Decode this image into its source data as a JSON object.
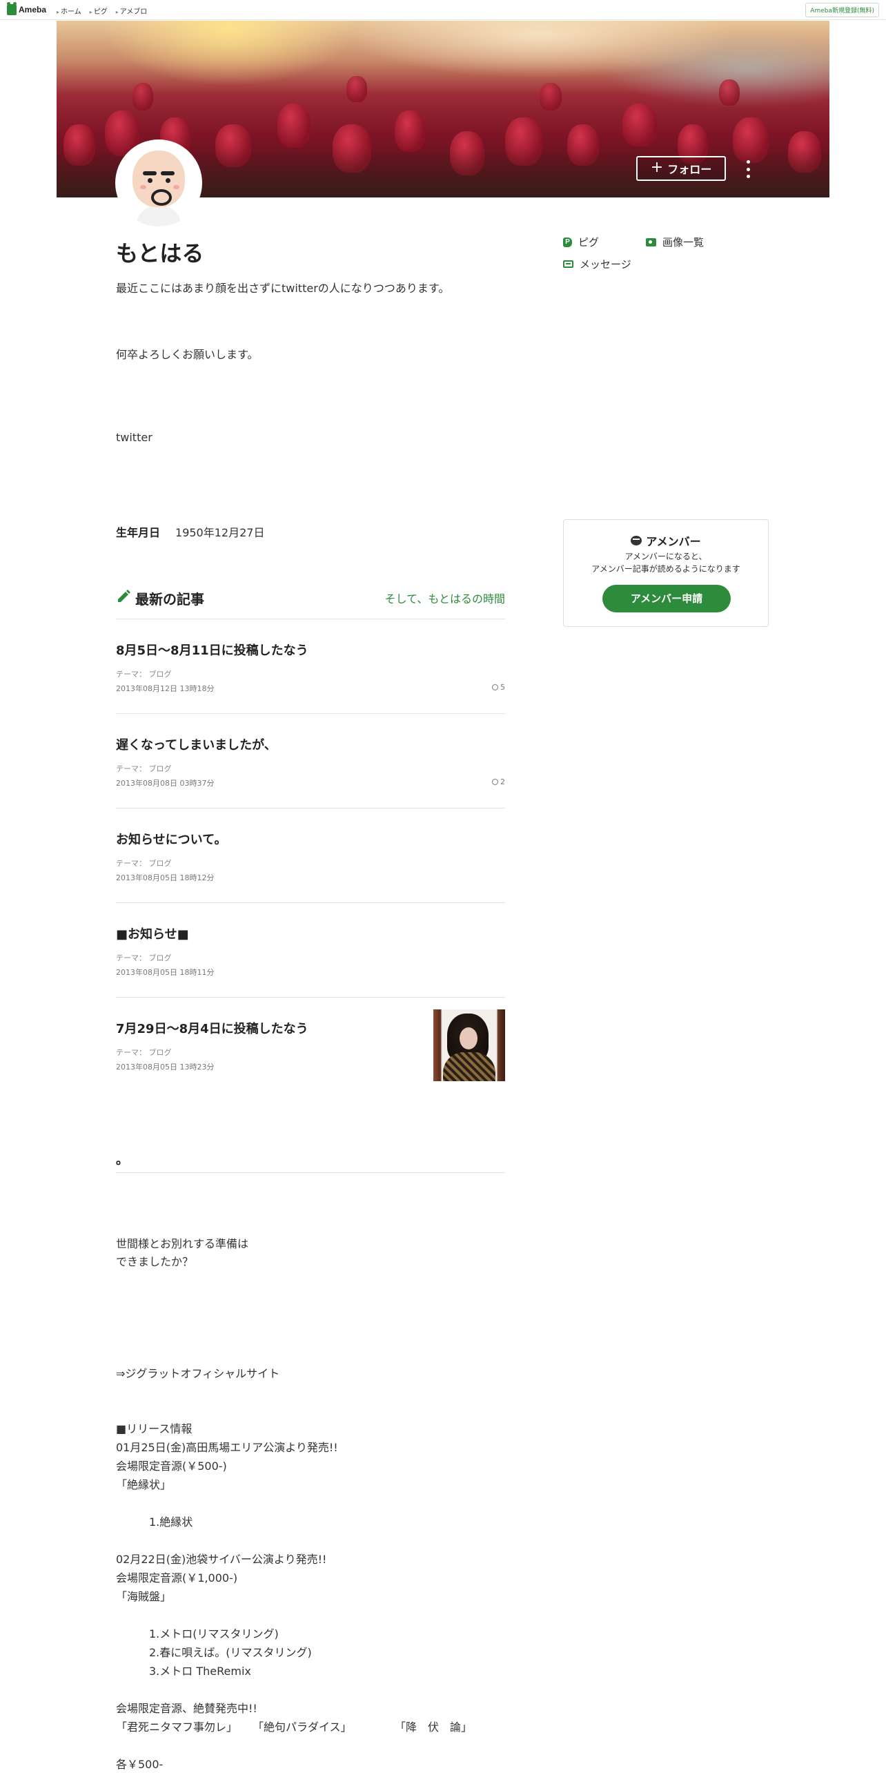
{
  "topbar": {
    "logo_text": "Ameba",
    "nav": [
      "ホーム",
      "ピグ",
      "アメブロ"
    ],
    "signup": "Ameba新規登録(無料)"
  },
  "header": {
    "follow_label": "フォロー"
  },
  "profile": {
    "name": "もとはる",
    "bio": [
      "最近ここにはあまり顔を出さずにtwitterの人になりつつあります。",
      "何卒よろしくお願いします。",
      "twitter"
    ],
    "birth_label": "生年月日",
    "birth_value": "1950年12月27日"
  },
  "side_links": {
    "pigg": "ピグ",
    "images": "画像一覧",
    "message": "メッセージ"
  },
  "amember": {
    "title": "アメンバー",
    "desc_line1": "アメンバーになると、",
    "desc_line2": "アメンバー記事が読めるようになります",
    "button": "アメンバー申請"
  },
  "articles_section": {
    "title": "最新の記事",
    "link": "そして、もとはるの時間"
  },
  "articles": [
    {
      "title": "8月5日〜8月11日に投稿したなう",
      "theme": "テーマ： ブログ",
      "date": "2013年08月12日 13時18分",
      "comments": "5"
    },
    {
      "title": "遅くなってしまいましたが、",
      "theme": "テーマ： ブログ",
      "date": "2013年08月08日 03時37分",
      "comments": "2"
    },
    {
      "title": "お知らせについて。",
      "theme": "テーマ： ブログ",
      "date": "2013年08月05日 18時12分",
      "comments": ""
    },
    {
      "title": "■お知らせ■",
      "theme": "テーマ： ブログ",
      "date": "2013年08月05日 18時11分",
      "comments": ""
    },
    {
      "title": "7月29日〜8月4日に投稿したなう",
      "theme": "テーマ： ブログ",
      "date": "2013年08月05日 13時23分",
      "comments": ""
    }
  ],
  "post": {
    "heading": "。",
    "lines": [
      "世間様とお別れする準備は",
      "できましたか？",
      "⇒ジグラットオフィシャルサイト",
      "■リリース情報",
      "01月25日(金)高田馬場エリア公演より発売!!",
      "会場限定音源(￥500-)",
      "「絶縁状」",
      "1.絶縁状",
      "02月22日(金)池袋サイバー公演より発売!!",
      "会場限定音源(￥1,000-)",
      "「海賊盤」",
      "1.メトロ(リマスタリング)",
      "2.春に唄えば。(リマスタリング)",
      "3.メトロ TheRemix",
      "会場限定音源、絶賛発売中!!",
      "「君死ニタマフ事勿レ」",
      "「絶句パラダイス」",
      "「降　伏　論」",
      "各￥500-"
    ]
  },
  "colors": {
    "accent": "#2d8c3c"
  }
}
